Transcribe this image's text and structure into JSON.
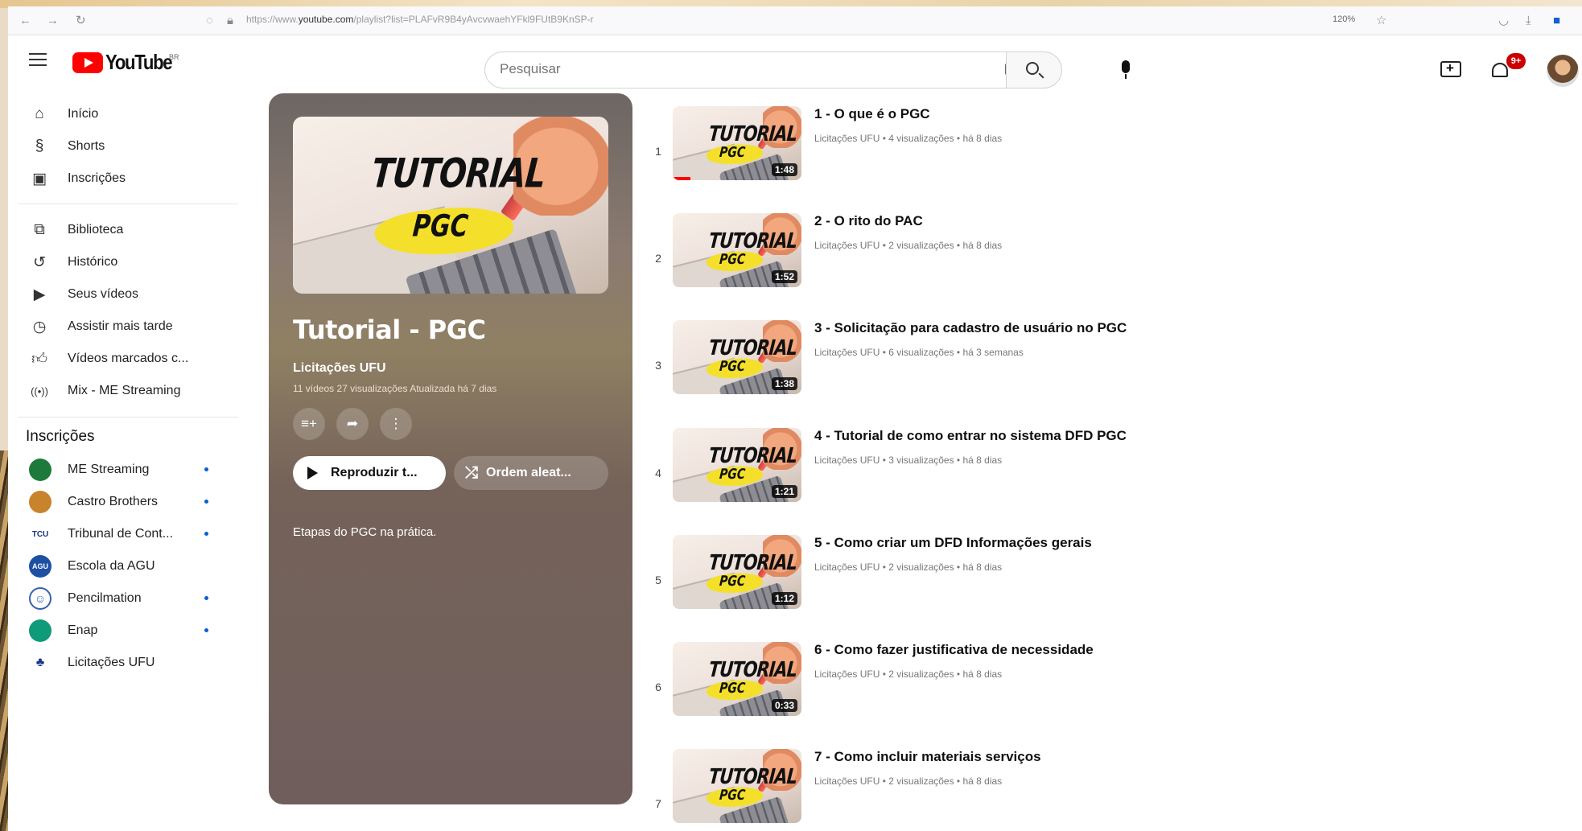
{
  "browser": {
    "url_prefix": "https://www.",
    "url_domain": "youtube.com",
    "url_rest": "/playlist?list=PLAFvR9B4yAvcvwaehYFkl9FUtB9KnSP-r",
    "zoom": "120%"
  },
  "masthead": {
    "logo_text": "YouTube",
    "country_code": "BR",
    "search_placeholder": "Pesquisar",
    "notification_count": "9+"
  },
  "sidebar": {
    "main_items": [
      {
        "label": "Início",
        "icon": "home-icon"
      },
      {
        "label": "Shorts",
        "icon": "shorts-icon"
      },
      {
        "label": "Inscrições",
        "icon": "subscriptions-icon"
      }
    ],
    "library_items": [
      {
        "label": "Biblioteca",
        "icon": "library-icon"
      },
      {
        "label": "Histórico",
        "icon": "history-icon"
      },
      {
        "label": "Seus vídeos",
        "icon": "your-videos-icon"
      },
      {
        "label": "Assistir mais tarde",
        "icon": "watch-later-icon"
      },
      {
        "label": "Vídeos marcados c...",
        "icon": "liked-icon"
      },
      {
        "label": "Mix - ME Streaming",
        "icon": "mix-icon"
      }
    ],
    "subscriptions_heading": "Inscrições",
    "subscriptions": [
      {
        "label": "ME Streaming",
        "color": "#1e7a3c",
        "badge": "",
        "new": true
      },
      {
        "label": "Castro Brothers",
        "color": "#c8842c",
        "badge": "",
        "new": true
      },
      {
        "label": "Tribunal de Cont...",
        "color": "#ffffff",
        "badge": "TCU",
        "new": true
      },
      {
        "label": "Escola da AGU",
        "color": "#1d4fa3",
        "badge": "AGU",
        "new": false
      },
      {
        "label": "Pencilmation",
        "color": "#3a5fae",
        "badge": "",
        "new": true
      },
      {
        "label": "Enap",
        "color": "#0f9a7a",
        "badge": "",
        "new": true
      },
      {
        "label": "Licitações UFU",
        "color": "#1a3a8a",
        "badge": "",
        "new": false
      }
    ]
  },
  "playlist": {
    "thumb_line1": "TUTORIAL",
    "thumb_line2": "PGC",
    "title": "Tutorial - PGC",
    "owner": "Licitações UFU",
    "stats": "11 vídeos  27 visualizações  Atualizada há 7 dias",
    "play_label": "Reproduzir t...",
    "shuffle_label": "Ordem aleat...",
    "description": "Etapas do PGC na prática."
  },
  "videos": [
    {
      "index": "1",
      "title": "1 - O que é o PGC",
      "meta": "Licitações UFU • 4 visualizações • há 8 dias",
      "duration": "1:48"
    },
    {
      "index": "2",
      "title": "2 - O rito do PAC",
      "meta": "Licitações UFU • 2 visualizações • há 8 dias",
      "duration": "1:52"
    },
    {
      "index": "3",
      "title": "3 - Solicitação para cadastro de usuário no PGC",
      "meta": "Licitações UFU • 6 visualizações • há 3 semanas",
      "duration": "1:38"
    },
    {
      "index": "4",
      "title": "4 - Tutorial de como entrar no sistema DFD PGC",
      "meta": "Licitações UFU • 3 visualizações • há 8 dias",
      "duration": "1:21"
    },
    {
      "index": "5",
      "title": "5 - Como criar um DFD Informações gerais",
      "meta": "Licitações UFU • 2 visualizações • há 8 dias",
      "duration": "1:12"
    },
    {
      "index": "6",
      "title": "6 - Como fazer justificativa de necessidade",
      "meta": "Licitações UFU • 2 visualizações • há 8 dias",
      "duration": "0:33"
    },
    {
      "index": "7",
      "title": "7 - Como incluir materiais serviços",
      "meta": "Licitações UFU • 2 visualizações • há 8 dias",
      "duration": ""
    }
  ]
}
